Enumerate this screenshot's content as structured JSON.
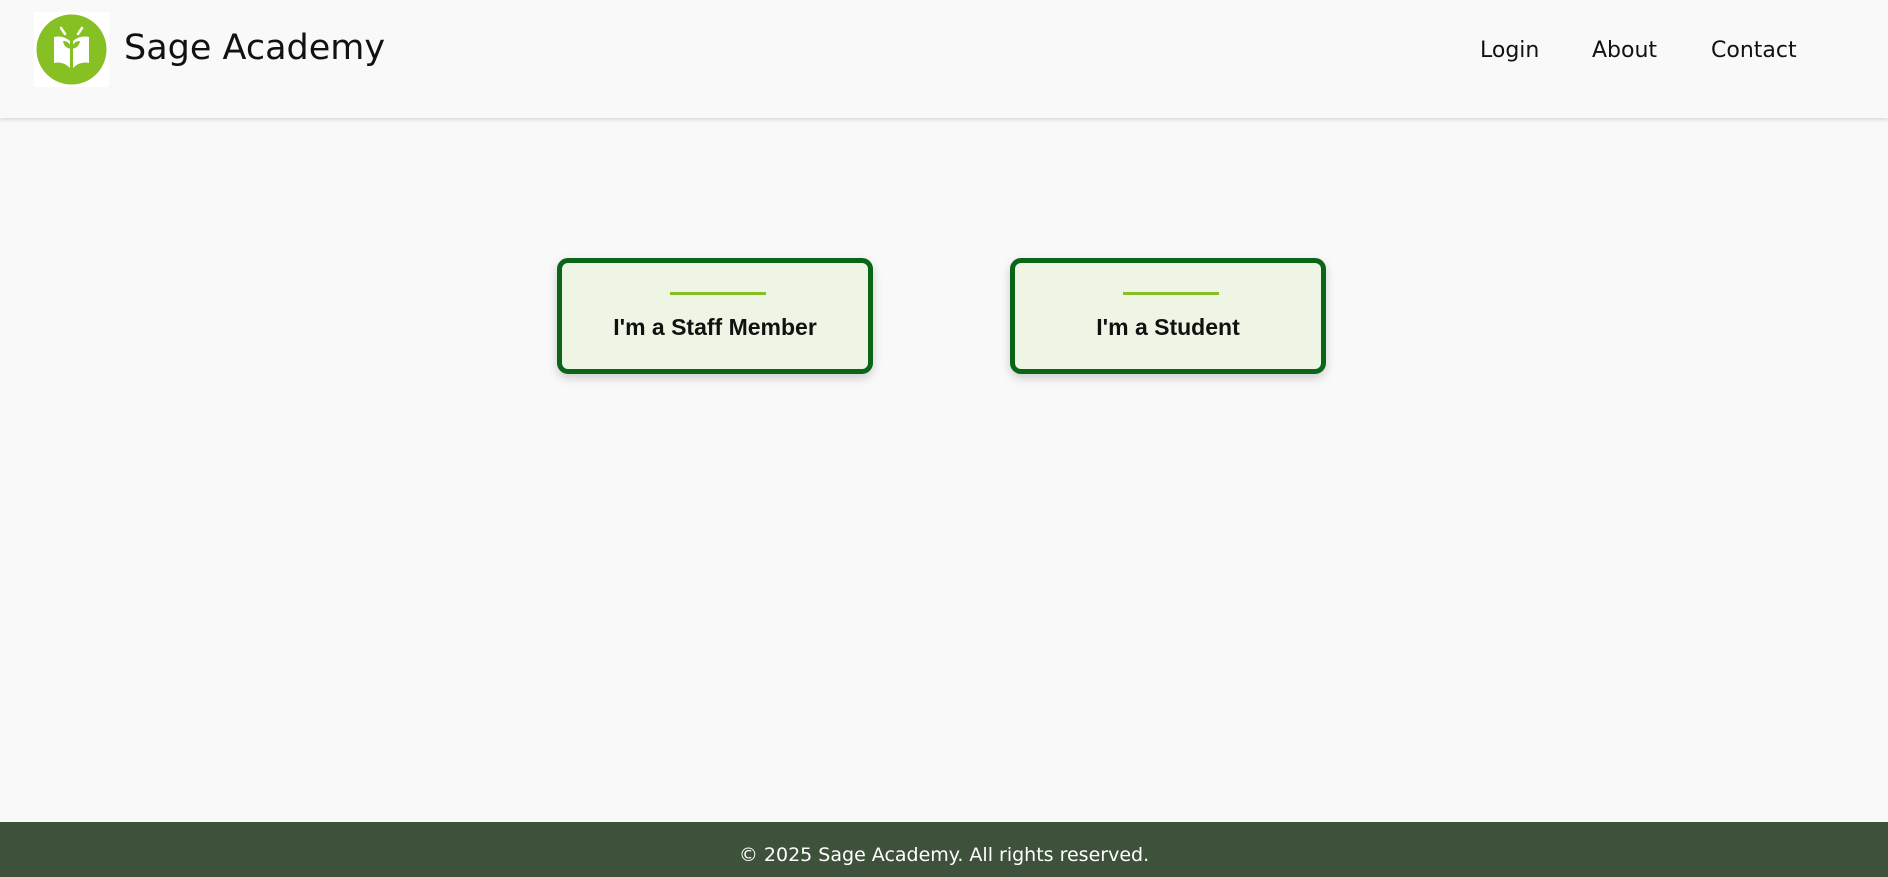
{
  "header": {
    "brand_name": "Sage Academy",
    "logo_icon": "book-sprout-icon",
    "nav": {
      "login": "Login",
      "about": "About",
      "contact": "Contact"
    }
  },
  "main": {
    "cards": [
      {
        "label": "I'm a Staff Member"
      },
      {
        "label": "I'm a Student"
      }
    ]
  },
  "footer": {
    "copyright": "© 2025 Sage Academy. All rights reserved."
  },
  "colors": {
    "background": "#f9f9f9",
    "logo_green": "#86c022",
    "card_border": "#0b6518",
    "card_fill": "#eef5e4",
    "card_accent": "#86c022",
    "footer_bg": "#3e513a"
  }
}
